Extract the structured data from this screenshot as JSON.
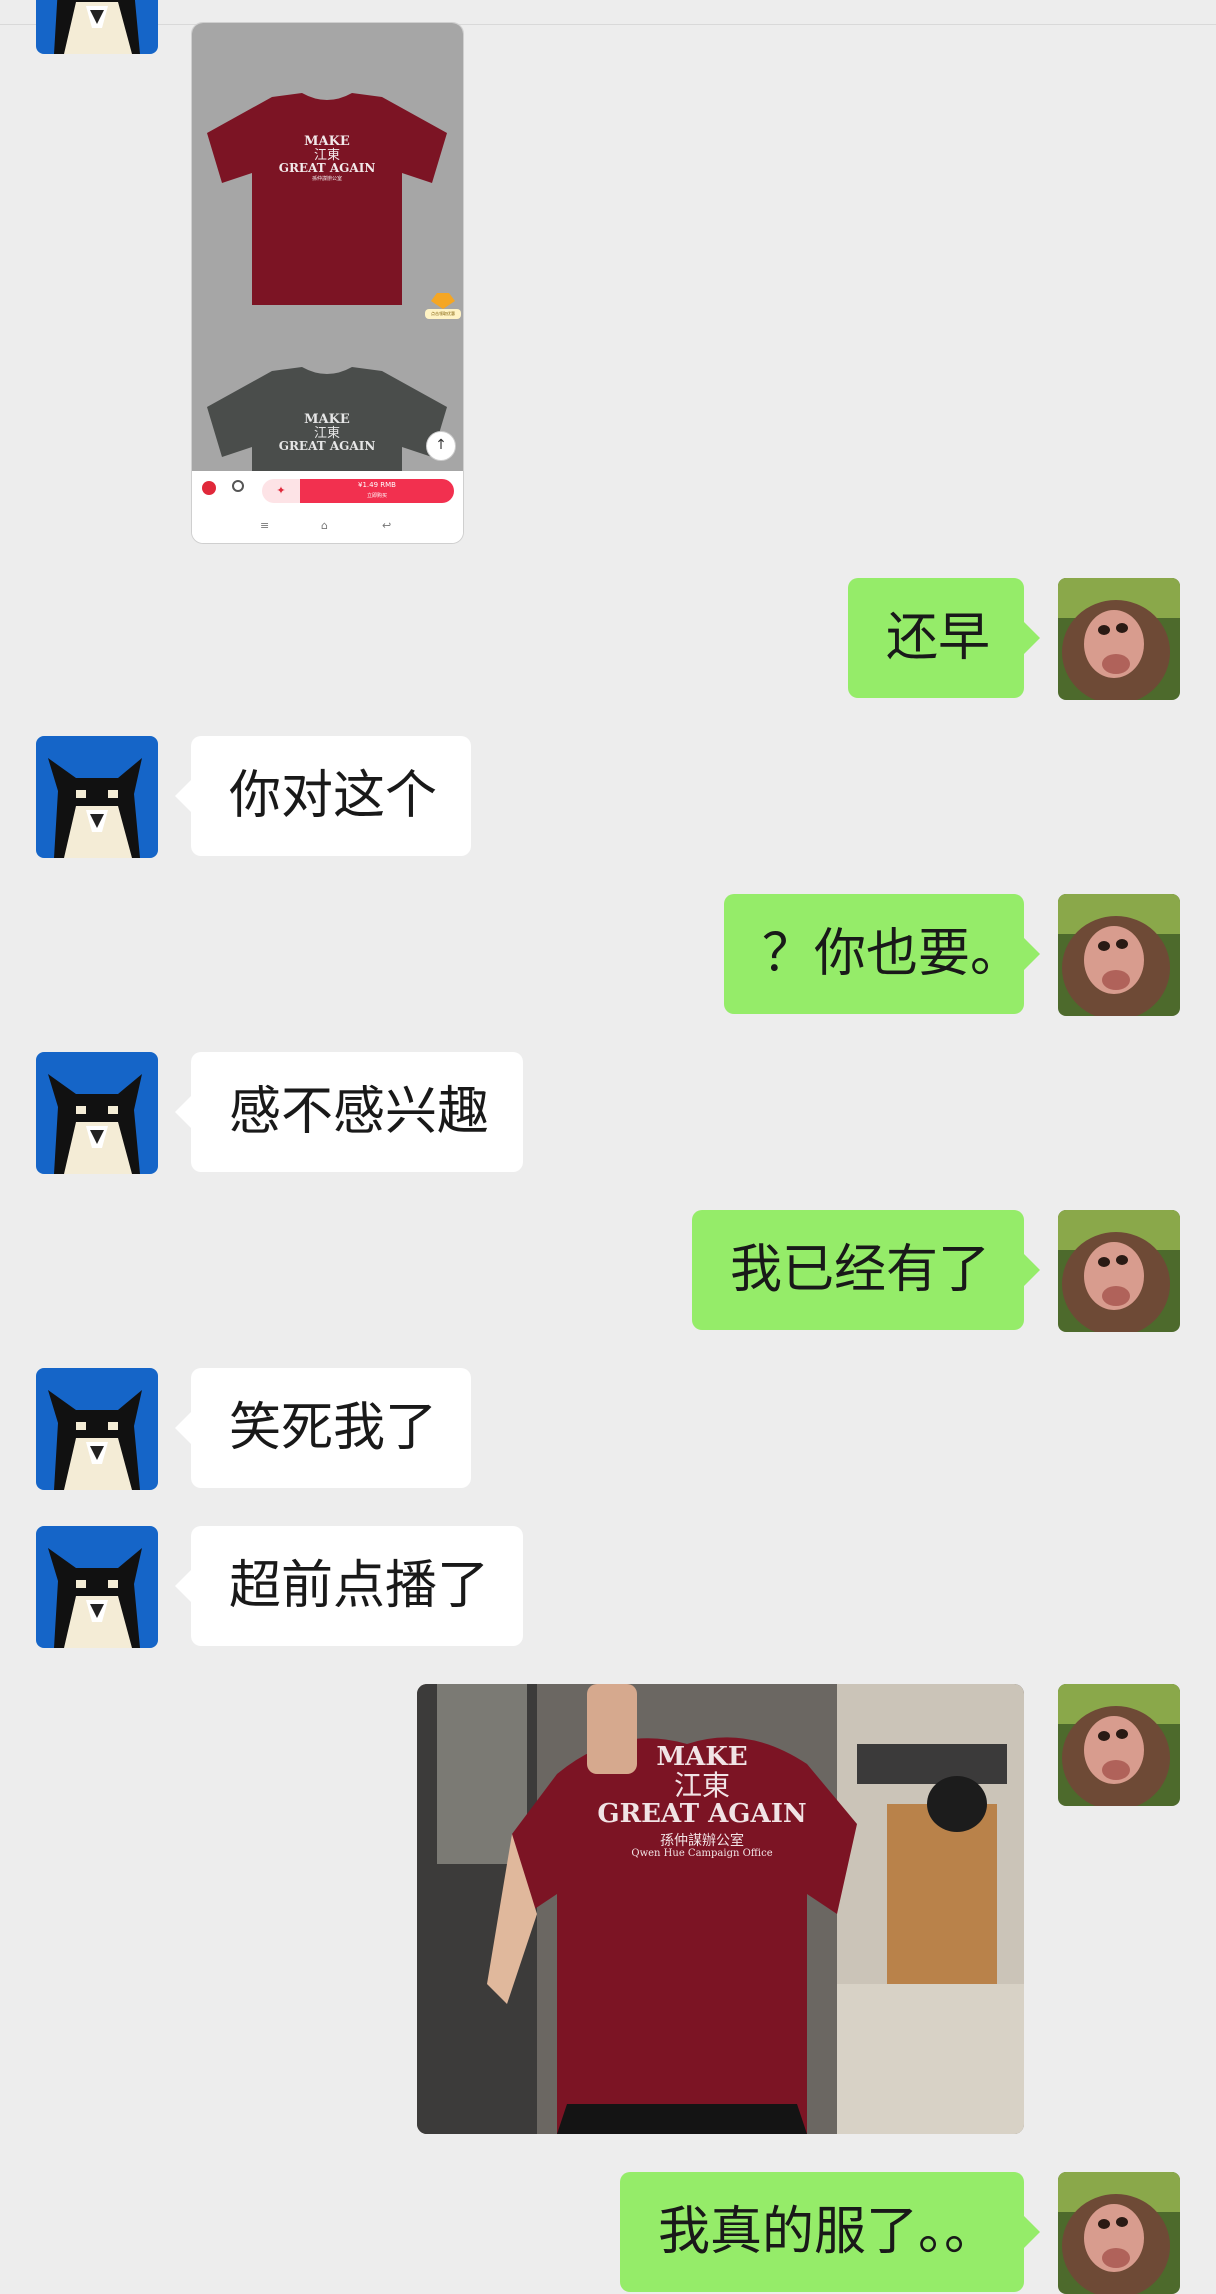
{
  "chat": {
    "messages": [
      {
        "side": "left",
        "type": "image",
        "kind": "product-screenshot"
      },
      {
        "side": "right",
        "type": "text",
        "text": "还早"
      },
      {
        "side": "left",
        "type": "text",
        "text": "你对这个"
      },
      {
        "side": "right",
        "type": "text",
        "text": "？你也要。"
      },
      {
        "side": "left",
        "type": "text",
        "text": "感不感兴趣"
      },
      {
        "side": "right",
        "type": "text",
        "text": "我已经有了"
      },
      {
        "side": "left",
        "type": "text",
        "text": "笑死我了"
      },
      {
        "side": "left",
        "type": "text",
        "text": "超前点播了"
      },
      {
        "side": "right",
        "type": "image",
        "kind": "mirror-selfie-photo"
      },
      {
        "side": "right",
        "type": "text",
        "text": "我真的服了。。"
      }
    ]
  },
  "shirt_print": {
    "line1": "MAKE",
    "line2": "江東",
    "line3": "GREAT AGAIN",
    "line4": "孫仲謀辦公室",
    "line5": "Qwen Hue Campaign Office"
  },
  "product_page": {
    "buy_button_label": "¥1.49 RMB",
    "buy_button_sub": "立即购买",
    "floating_tag": "点击领取优惠"
  },
  "colors": {
    "background": "#ededed",
    "self_bubble": "#95ec69",
    "other_bubble": "#ffffff",
    "shirt_red": "#7c1424",
    "shirt_grey": "#4a4d4b",
    "buy_red": "#f2304f"
  }
}
